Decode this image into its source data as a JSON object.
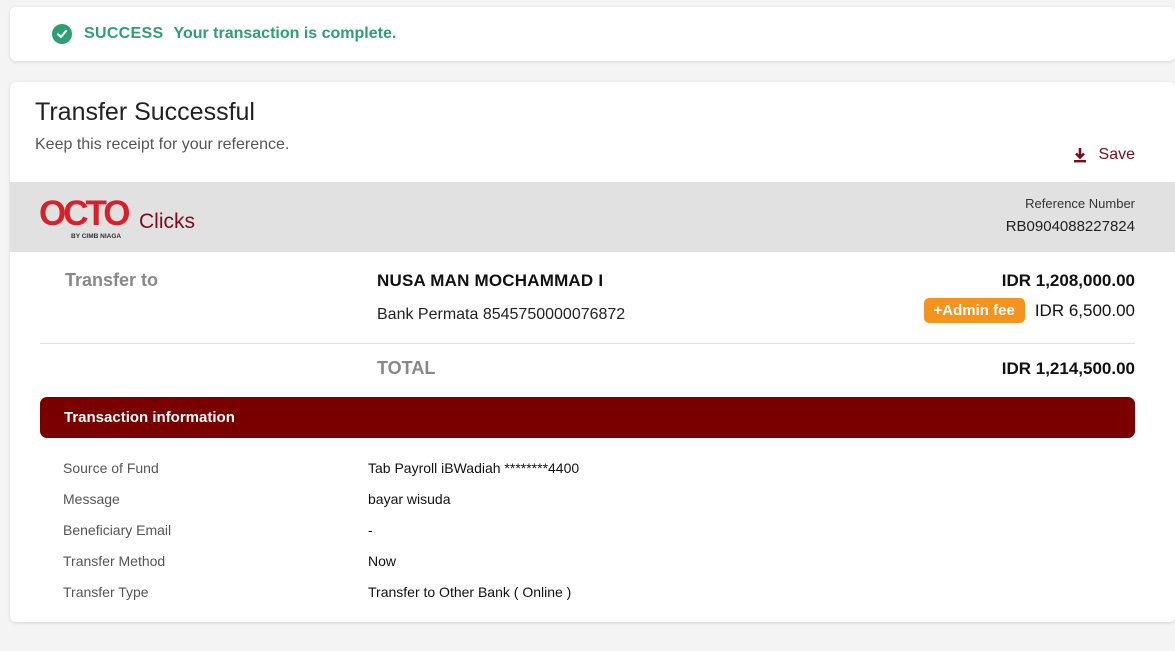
{
  "alert": {
    "status": "SUCCESS",
    "message": "Your transaction is complete."
  },
  "receipt": {
    "title": "Transfer Successful",
    "subtitle": "Keep this receipt for your reference.",
    "save_label": "Save",
    "reference_label": "Reference Number",
    "reference_number": "RB0904088227824"
  },
  "logo": {
    "word1": "OCTO",
    "word2": "Clicks",
    "tagline": "BY CIMB NIAGA",
    "colors": {
      "red": "#d8202a",
      "dark_red": "#7a0c1c"
    }
  },
  "transfer": {
    "label": "Transfer to",
    "beneficiary_name": "NUSA MAN MOCHAMMAD I",
    "beneficiary_bank": "Bank Permata 8545750000076872",
    "amount": "IDR 1,208,000.00",
    "fee_label": "+Admin fee",
    "fee_amount": "IDR 6,500.00",
    "total_label": "TOTAL",
    "total_amount": "IDR 1,214,500.00"
  },
  "info": {
    "header": "Transaction information",
    "rows": [
      {
        "key": "Source of Fund",
        "value": "Tab Payroll iBWadiah ********4400"
      },
      {
        "key": "Message",
        "value": "bayar wisuda"
      },
      {
        "key": "Beneficiary Email",
        "value": "-"
      },
      {
        "key": "Transfer Method",
        "value": "Now"
      },
      {
        "key": "Transfer Type",
        "value": "Transfer to Other Bank ( Online )"
      }
    ]
  },
  "colors": {
    "success": "#2e9e74",
    "accent": "#7a0000",
    "fee_badge": "#f5931f"
  }
}
